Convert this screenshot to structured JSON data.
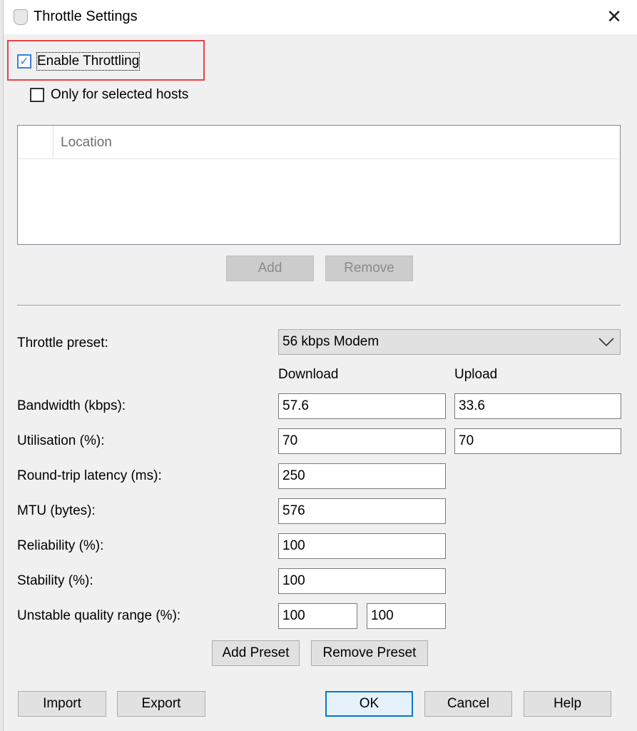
{
  "window": {
    "title": "Throttle Settings",
    "close_icon": "close-icon",
    "app_icon": "pitcher-icon"
  },
  "enable_throttling": {
    "label": "Enable Throttling",
    "checked": true
  },
  "only_selected_hosts": {
    "label": "Only for selected hosts",
    "checked": false
  },
  "hosts_list": {
    "columns": [
      "Location"
    ],
    "rows": []
  },
  "hosts_buttons": {
    "add": "Add",
    "remove": "Remove"
  },
  "preset": {
    "label": "Throttle preset:",
    "value": "56 kbps Modem"
  },
  "columns": {
    "download": "Download",
    "upload": "Upload"
  },
  "fields": [
    {
      "label": "Bandwidth (kbps):",
      "download": "57.6",
      "upload": "33.6"
    },
    {
      "label": "Utilisation (%):",
      "download": "70",
      "upload": "70"
    },
    {
      "label": "Round-trip latency (ms):",
      "value": "250"
    },
    {
      "label": "MTU (bytes):",
      "value": "576"
    },
    {
      "label": "Reliability (%):",
      "value": "100"
    },
    {
      "label": "Stability (%):",
      "value": "100"
    },
    {
      "label": "Unstable quality range (%):",
      "min": "100",
      "max": "100"
    }
  ],
  "preset_buttons": {
    "add": "Add Preset",
    "remove": "Remove Preset"
  },
  "footer": {
    "import": "Import",
    "export": "Export",
    "ok": "OK",
    "cancel": "Cancel",
    "help": "Help"
  },
  "colors": {
    "highlight": "#e8414a",
    "accent": "#0078d7"
  }
}
